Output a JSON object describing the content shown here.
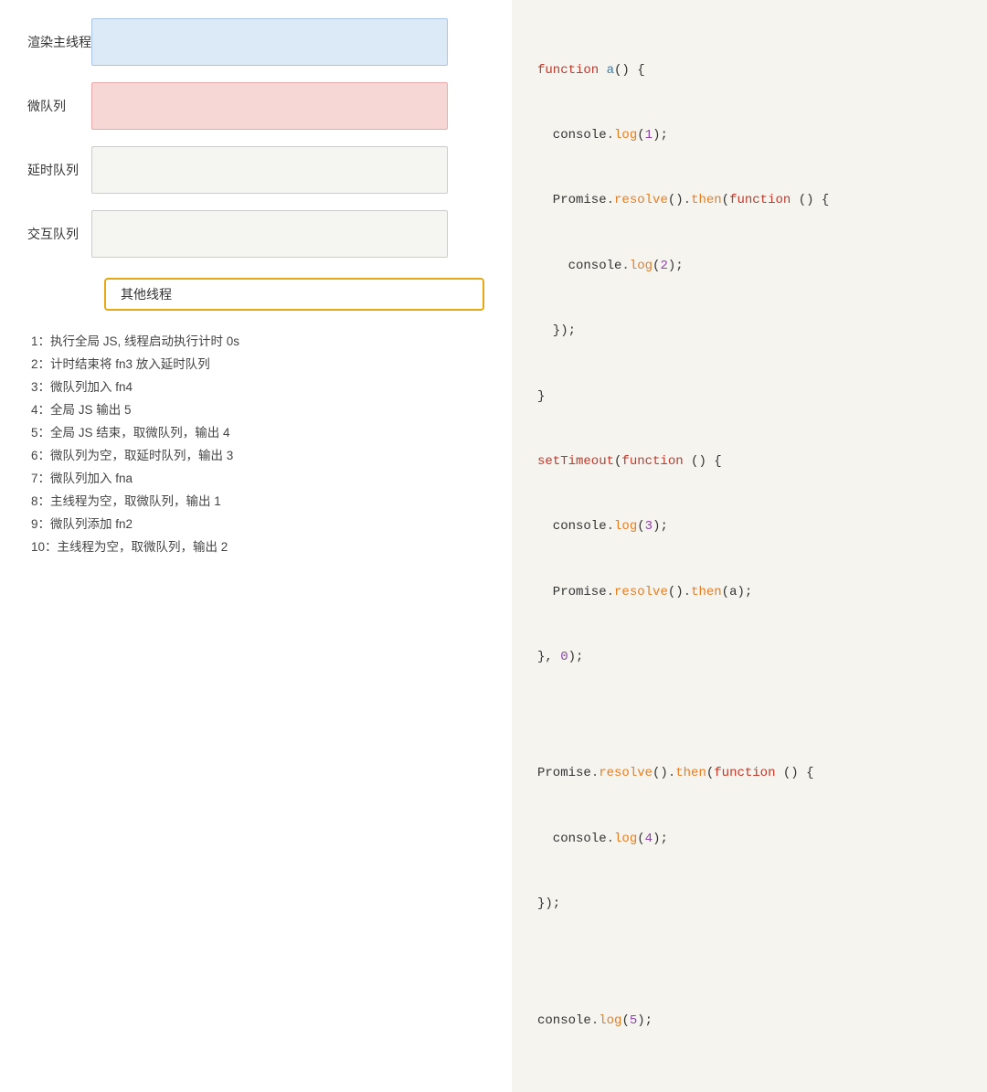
{
  "left": {
    "queues": [
      {
        "id": "render-main",
        "label": "渲染主线程",
        "style": "render-main"
      },
      {
        "id": "micro",
        "label": "微队列",
        "style": "micro"
      },
      {
        "id": "delay",
        "label": "延时队列",
        "style": "delay"
      },
      {
        "id": "interaction",
        "label": "交互队列",
        "style": "interaction"
      }
    ],
    "other_thread_btn": "其他线程",
    "steps": [
      "1：执行全局 JS, 线程启动执行计时 0s",
      "2：计时结束将 fn3 放入延时队列",
      "3：微队列加入 fn4",
      "4：全局 JS 输出 5",
      "5：全局 JS 结束，取微队列，输出 4",
      "6：微队列为空，取延时队列，输出 3",
      "7：微队列加入 fna",
      "8：主线程为空，取微队列，输出 1",
      "9：微队列添加 fn2",
      "10：主线程为空，取微队列，输出 2"
    ]
  },
  "right": {
    "title": "code-panel"
  }
}
